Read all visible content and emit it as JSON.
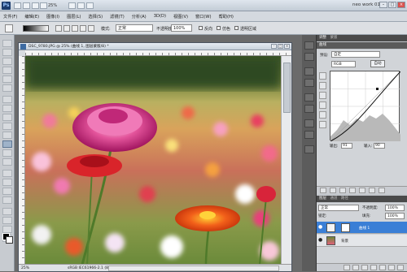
{
  "app": {
    "zoom": "25%",
    "workspace": "neo work 01"
  },
  "menu": [
    "文件(F)",
    "编辑(E)",
    "图像(I)",
    "图层(L)",
    "选择(S)",
    "滤镜(T)",
    "分析(A)",
    "3D(D)",
    "视图(V)",
    "窗口(W)",
    "帮助(H)"
  ],
  "options": {
    "mode_label": "模式:",
    "mode_value": "正常",
    "opacity_label": "不透明度:",
    "opacity_value": "100%",
    "reverse_label": "反向",
    "dither_label": "仿色",
    "transparency_label": "透明区域"
  },
  "document": {
    "title": "DSC_9780.JPG @ 25% (曲线 1, 图层蒙版/8) *",
    "status_zoom": "25%",
    "status_info": "sRGB IEC61966-2.1 (8bpc)"
  },
  "panels": {
    "tab_top_1": "调整",
    "tab_top_2": "蒙版",
    "curves_tab": "曲线",
    "preset_label": "预设:",
    "preset_value": "自定",
    "channel_value": "RGB",
    "auto_button": "自动",
    "output_label": "输出:",
    "output_value": "91",
    "input_label": "输入:",
    "input_value": "90"
  },
  "layers": {
    "tab_1": "图层",
    "tab_2": "通道",
    "tab_3": "路径",
    "blend_mode": "正常",
    "opacity_label": "不透明度:",
    "opacity_value": "100%",
    "lock_label": "锁定:",
    "fill_label": "填充:",
    "fill_value": "100%",
    "items": [
      {
        "name": "曲线 1",
        "selected": true
      },
      {
        "name": "背景",
        "selected": false
      }
    ]
  }
}
